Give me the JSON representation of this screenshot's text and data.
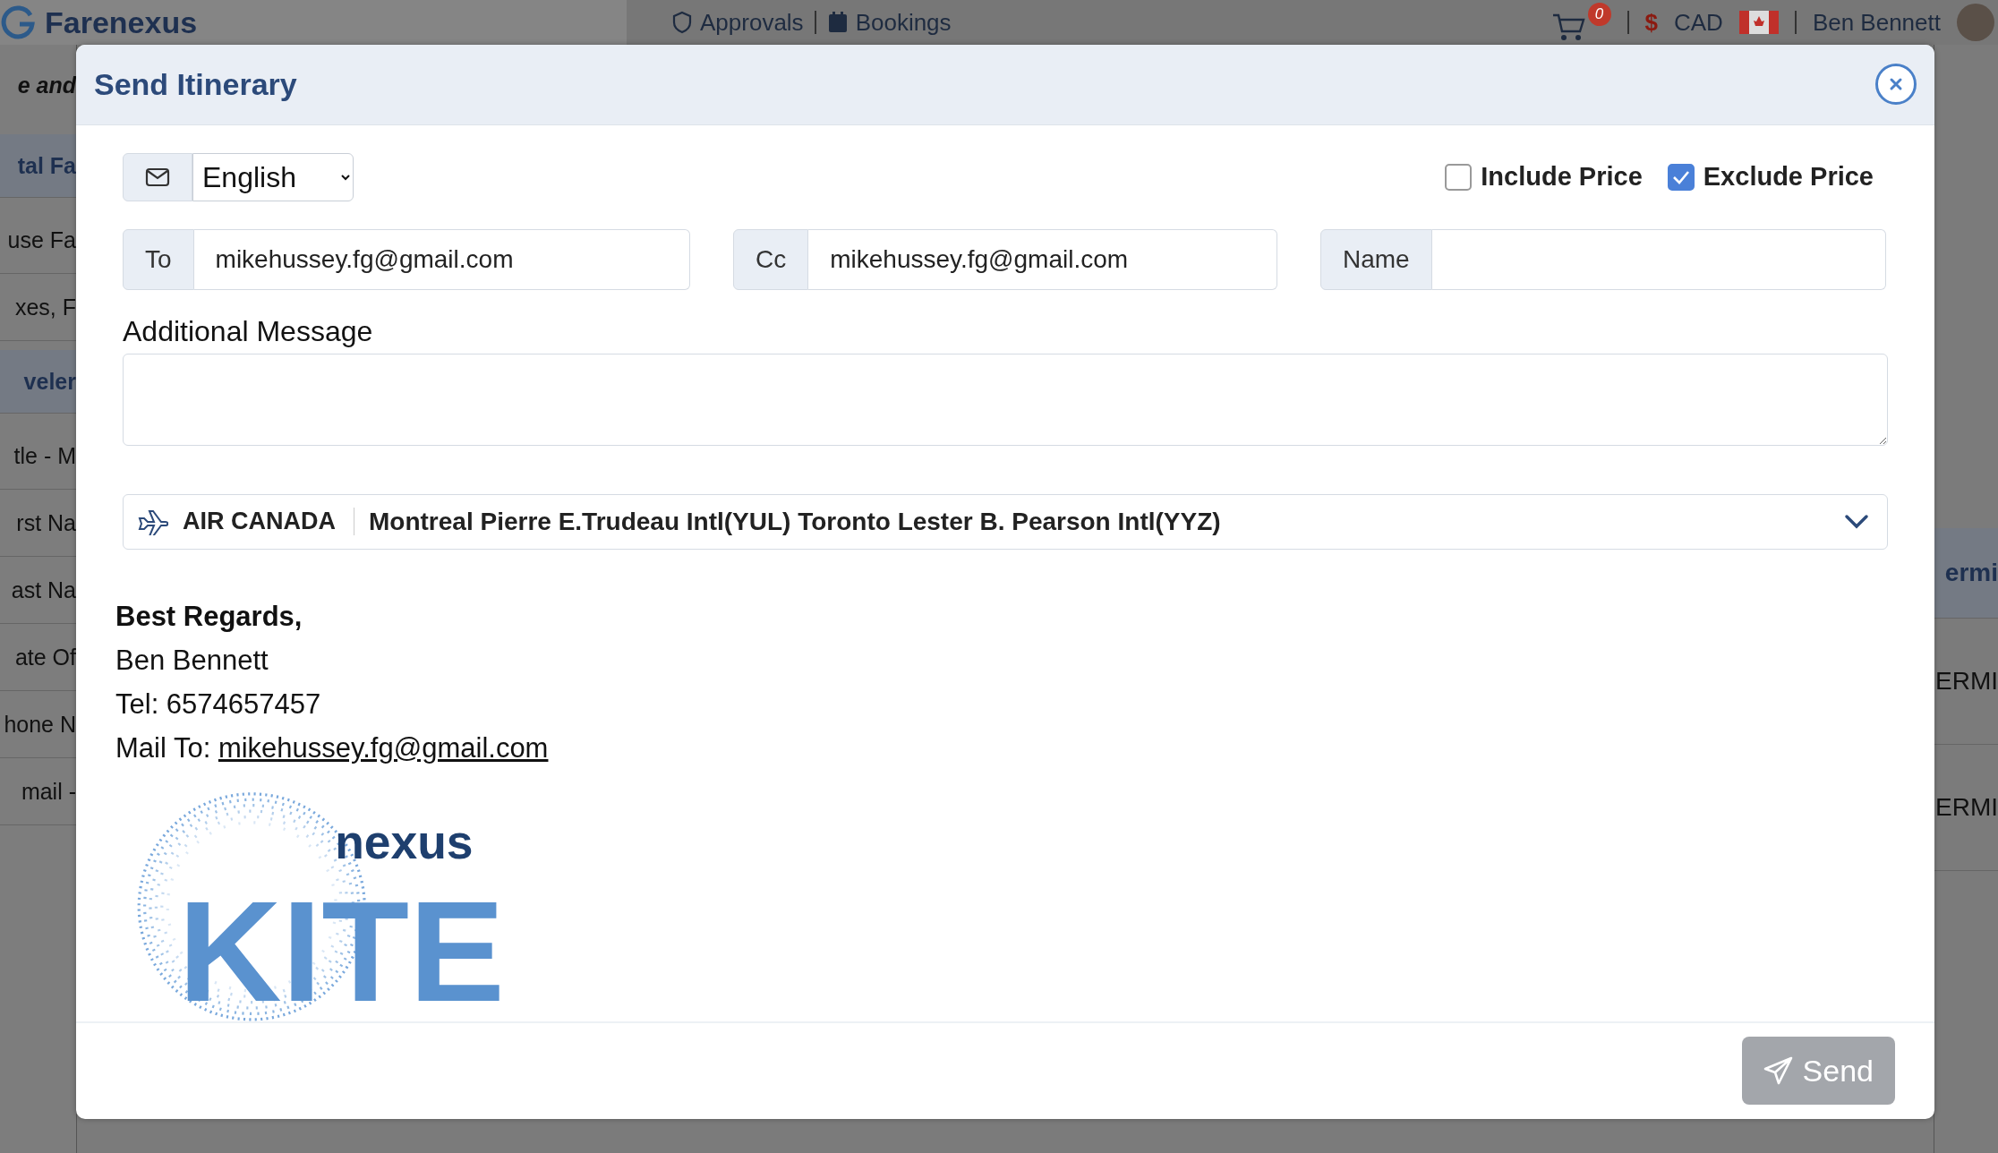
{
  "background": {
    "brand": "Farenexus",
    "nav": [
      {
        "label": "Approvals",
        "kind": "shield"
      },
      {
        "label": "Bookings",
        "kind": "calendar"
      }
    ],
    "cart_count": "0",
    "currency_symbol": "$",
    "currency": "CAD",
    "user": "Ben Bennett",
    "left_fragments": [
      {
        "text": "e and",
        "kind": "italic"
      },
      {
        "text": "tal Fa",
        "kind": "header"
      },
      {
        "text": "use Fa",
        "kind": "row"
      },
      {
        "text": "xes, F",
        "kind": "row"
      },
      {
        "text": "veler",
        "kind": "header"
      },
      {
        "text": "tle - M",
        "kind": "row"
      },
      {
        "text": "rst Na",
        "kind": "row"
      },
      {
        "text": "ast Na",
        "kind": "row"
      },
      {
        "text": "ate Of",
        "kind": "row"
      },
      {
        "text": "hone N",
        "kind": "row"
      },
      {
        "text": "mail -",
        "kind": "row"
      }
    ],
    "right_fragments": [
      {
        "text": "ermi",
        "kind": "header"
      },
      {
        "text": "ERMI",
        "kind": "row"
      },
      {
        "text": "ERMI",
        "kind": "row"
      }
    ]
  },
  "dialog": {
    "title": "Send Itinerary",
    "language": "English",
    "price_options": [
      {
        "label": "Include Price",
        "checked": false
      },
      {
        "label": "Exclude Price",
        "checked": true
      }
    ],
    "recipients": [
      {
        "label": "To",
        "value": "mikehussey.fg@gmail.com"
      },
      {
        "label": "Cc",
        "value": "mikehussey.fg@gmail.com"
      },
      {
        "label": "Name"
      }
    ],
    "message_label": "Additional Message",
    "flight": {
      "airline": "AIR CANADA",
      "route": "Montreal Pierre E.Trudeau Intl(YUL) Toronto Lester B. Pearson Intl(YYZ)",
      "expanded": false
    },
    "signature": {
      "greeting": "Best Regards,",
      "name": "Ben Bennett",
      "tel": "Tel: 6574657457",
      "mail_label": "Mail To:",
      "mail": "mikehussey.fg@gmail.com"
    },
    "logo": {
      "top": "nexus",
      "bottom": "KITE"
    },
    "send": {
      "label": "Send",
      "disabled": true
    }
  }
}
